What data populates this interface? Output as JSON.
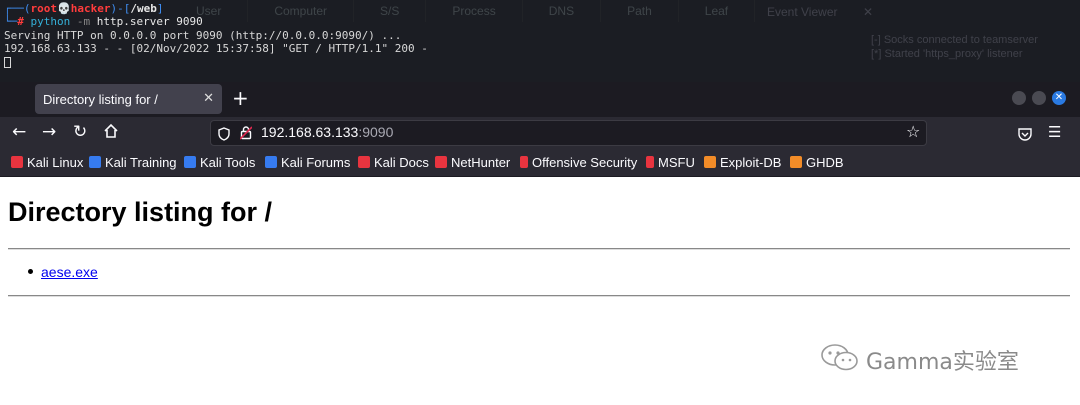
{
  "terminal": {
    "prompt_open": "┌──(",
    "user": "root",
    "skull": "💀",
    "host": "hacker",
    "prompt_mid": ")-[",
    "dir": "/web",
    "prompt_close": "]",
    "prompt_line2": "└─",
    "hash": "#",
    "command": "python",
    "option": "-m",
    "args": "http.server 9090",
    "output_1": "Serving HTTP on 0.0.0.0 port 9090 (http://0.0.0.0:9090/) ...",
    "output_2": "192.168.63.133 - - [02/Nov/2022 15:37:58] \"GET / HTTP/1.1\" 200 -",
    "bg_tabs": [
      "User",
      "Computer",
      "S/S",
      "Process",
      "DNS",
      "Path",
      "Leaf"
    ],
    "bg_panel_title": "Event Viewer",
    "bg_panel_line1": "[-] Socks connected to teamserver",
    "bg_panel_line2": "[*] Started 'https_proxy' listener"
  },
  "browser": {
    "tab_title": "Directory listing for /",
    "tab_close": "✕",
    "new_tab": "+",
    "url_host": "192.168.63.133",
    "url_port": ":9090",
    "bookmarks": [
      {
        "label": "Kali Linux",
        "color": "#e8343f"
      },
      {
        "label": "Kali Training",
        "color": "#367bf0"
      },
      {
        "label": "Kali Tools",
        "color": "#367bf0"
      },
      {
        "label": "Kali Forums",
        "color": "#367bf0"
      },
      {
        "label": "Kali Docs",
        "color": "#e8343f"
      },
      {
        "label": "NetHunter",
        "color": "#e8343f"
      },
      {
        "label": "Offensive Security",
        "color": "#e8343f"
      },
      {
        "label": "MSFU",
        "color": "#e8343f"
      },
      {
        "label": "Exploit-DB",
        "color": "#f28c28"
      },
      {
        "label": "GHDB",
        "color": "#f28c28"
      }
    ]
  },
  "page": {
    "heading": "Directory listing for /",
    "files": [
      "aese.exe"
    ]
  },
  "watermark": {
    "text": "Gamma实验室"
  }
}
